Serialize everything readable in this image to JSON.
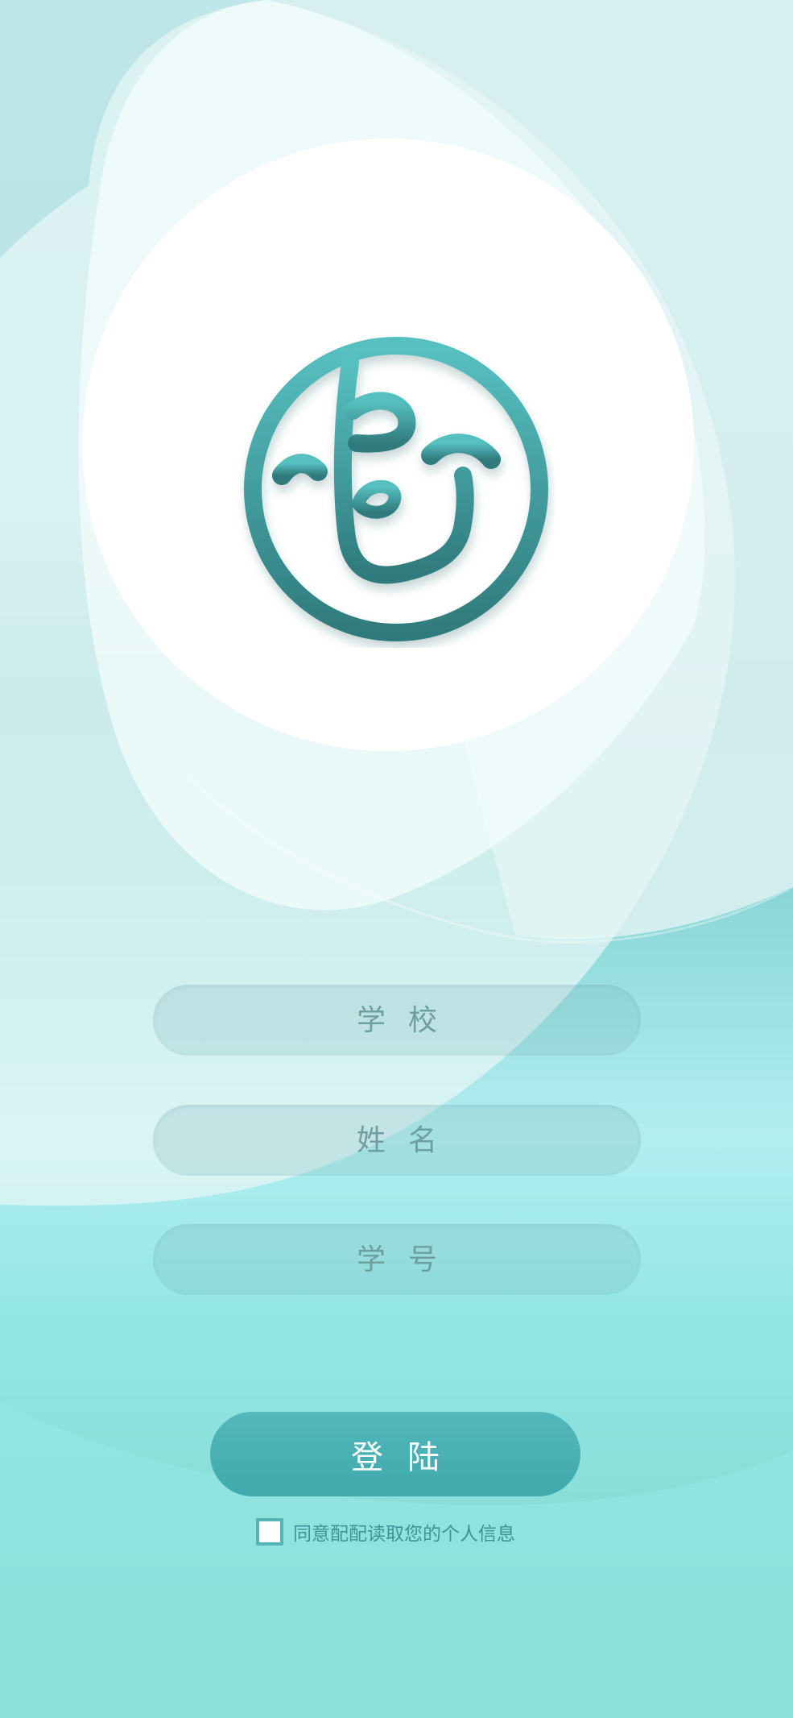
{
  "app": {
    "logo": {
      "icon": "smiling-face-logo-icon"
    }
  },
  "form": {
    "school_placeholder": "学校",
    "name_placeholder": "姓名",
    "student_id_placeholder": "学号"
  },
  "login_button": {
    "label": "登陆"
  },
  "agreement": {
    "checked": false,
    "text": "同意配配读取您的个人信息"
  },
  "colors": {
    "accent": "#4ab2b4",
    "accent_dark": "#2f7a7c",
    "background_top": "#bfe6e8",
    "background_bottom": "#7fdac9"
  }
}
